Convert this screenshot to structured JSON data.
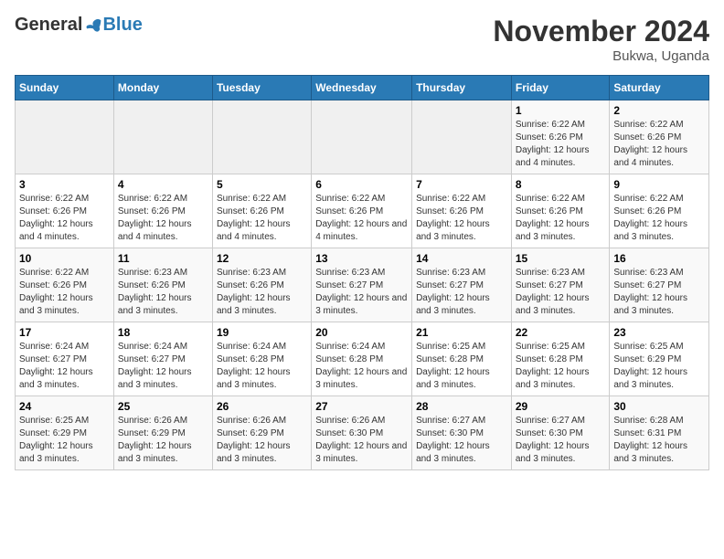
{
  "header": {
    "logo_general": "General",
    "logo_blue": "Blue",
    "month_title": "November 2024",
    "location": "Bukwa, Uganda"
  },
  "weekdays": [
    "Sunday",
    "Monday",
    "Tuesday",
    "Wednesday",
    "Thursday",
    "Friday",
    "Saturday"
  ],
  "weeks": [
    [
      {
        "day": "",
        "empty": true
      },
      {
        "day": "",
        "empty": true
      },
      {
        "day": "",
        "empty": true
      },
      {
        "day": "",
        "empty": true
      },
      {
        "day": "",
        "empty": true
      },
      {
        "day": "1",
        "sunrise": "Sunrise: 6:22 AM",
        "sunset": "Sunset: 6:26 PM",
        "daylight": "Daylight: 12 hours and 4 minutes."
      },
      {
        "day": "2",
        "sunrise": "Sunrise: 6:22 AM",
        "sunset": "Sunset: 6:26 PM",
        "daylight": "Daylight: 12 hours and 4 minutes."
      }
    ],
    [
      {
        "day": "3",
        "sunrise": "Sunrise: 6:22 AM",
        "sunset": "Sunset: 6:26 PM",
        "daylight": "Daylight: 12 hours and 4 minutes."
      },
      {
        "day": "4",
        "sunrise": "Sunrise: 6:22 AM",
        "sunset": "Sunset: 6:26 PM",
        "daylight": "Daylight: 12 hours and 4 minutes."
      },
      {
        "day": "5",
        "sunrise": "Sunrise: 6:22 AM",
        "sunset": "Sunset: 6:26 PM",
        "daylight": "Daylight: 12 hours and 4 minutes."
      },
      {
        "day": "6",
        "sunrise": "Sunrise: 6:22 AM",
        "sunset": "Sunset: 6:26 PM",
        "daylight": "Daylight: 12 hours and 4 minutes."
      },
      {
        "day": "7",
        "sunrise": "Sunrise: 6:22 AM",
        "sunset": "Sunset: 6:26 PM",
        "daylight": "Daylight: 12 hours and 3 minutes."
      },
      {
        "day": "8",
        "sunrise": "Sunrise: 6:22 AM",
        "sunset": "Sunset: 6:26 PM",
        "daylight": "Daylight: 12 hours and 3 minutes."
      },
      {
        "day": "9",
        "sunrise": "Sunrise: 6:22 AM",
        "sunset": "Sunset: 6:26 PM",
        "daylight": "Daylight: 12 hours and 3 minutes."
      }
    ],
    [
      {
        "day": "10",
        "sunrise": "Sunrise: 6:22 AM",
        "sunset": "Sunset: 6:26 PM",
        "daylight": "Daylight: 12 hours and 3 minutes."
      },
      {
        "day": "11",
        "sunrise": "Sunrise: 6:23 AM",
        "sunset": "Sunset: 6:26 PM",
        "daylight": "Daylight: 12 hours and 3 minutes."
      },
      {
        "day": "12",
        "sunrise": "Sunrise: 6:23 AM",
        "sunset": "Sunset: 6:26 PM",
        "daylight": "Daylight: 12 hours and 3 minutes."
      },
      {
        "day": "13",
        "sunrise": "Sunrise: 6:23 AM",
        "sunset": "Sunset: 6:27 PM",
        "daylight": "Daylight: 12 hours and 3 minutes."
      },
      {
        "day": "14",
        "sunrise": "Sunrise: 6:23 AM",
        "sunset": "Sunset: 6:27 PM",
        "daylight": "Daylight: 12 hours and 3 minutes."
      },
      {
        "day": "15",
        "sunrise": "Sunrise: 6:23 AM",
        "sunset": "Sunset: 6:27 PM",
        "daylight": "Daylight: 12 hours and 3 minutes."
      },
      {
        "day": "16",
        "sunrise": "Sunrise: 6:23 AM",
        "sunset": "Sunset: 6:27 PM",
        "daylight": "Daylight: 12 hours and 3 minutes."
      }
    ],
    [
      {
        "day": "17",
        "sunrise": "Sunrise: 6:24 AM",
        "sunset": "Sunset: 6:27 PM",
        "daylight": "Daylight: 12 hours and 3 minutes."
      },
      {
        "day": "18",
        "sunrise": "Sunrise: 6:24 AM",
        "sunset": "Sunset: 6:27 PM",
        "daylight": "Daylight: 12 hours and 3 minutes."
      },
      {
        "day": "19",
        "sunrise": "Sunrise: 6:24 AM",
        "sunset": "Sunset: 6:28 PM",
        "daylight": "Daylight: 12 hours and 3 minutes."
      },
      {
        "day": "20",
        "sunrise": "Sunrise: 6:24 AM",
        "sunset": "Sunset: 6:28 PM",
        "daylight": "Daylight: 12 hours and 3 minutes."
      },
      {
        "day": "21",
        "sunrise": "Sunrise: 6:25 AM",
        "sunset": "Sunset: 6:28 PM",
        "daylight": "Daylight: 12 hours and 3 minutes."
      },
      {
        "day": "22",
        "sunrise": "Sunrise: 6:25 AM",
        "sunset": "Sunset: 6:28 PM",
        "daylight": "Daylight: 12 hours and 3 minutes."
      },
      {
        "day": "23",
        "sunrise": "Sunrise: 6:25 AM",
        "sunset": "Sunset: 6:29 PM",
        "daylight": "Daylight: 12 hours and 3 minutes."
      }
    ],
    [
      {
        "day": "24",
        "sunrise": "Sunrise: 6:25 AM",
        "sunset": "Sunset: 6:29 PM",
        "daylight": "Daylight: 12 hours and 3 minutes."
      },
      {
        "day": "25",
        "sunrise": "Sunrise: 6:26 AM",
        "sunset": "Sunset: 6:29 PM",
        "daylight": "Daylight: 12 hours and 3 minutes."
      },
      {
        "day": "26",
        "sunrise": "Sunrise: 6:26 AM",
        "sunset": "Sunset: 6:29 PM",
        "daylight": "Daylight: 12 hours and 3 minutes."
      },
      {
        "day": "27",
        "sunrise": "Sunrise: 6:26 AM",
        "sunset": "Sunset: 6:30 PM",
        "daylight": "Daylight: 12 hours and 3 minutes."
      },
      {
        "day": "28",
        "sunrise": "Sunrise: 6:27 AM",
        "sunset": "Sunset: 6:30 PM",
        "daylight": "Daylight: 12 hours and 3 minutes."
      },
      {
        "day": "29",
        "sunrise": "Sunrise: 6:27 AM",
        "sunset": "Sunset: 6:30 PM",
        "daylight": "Daylight: 12 hours and 3 minutes."
      },
      {
        "day": "30",
        "sunrise": "Sunrise: 6:28 AM",
        "sunset": "Sunset: 6:31 PM",
        "daylight": "Daylight: 12 hours and 3 minutes."
      }
    ]
  ]
}
